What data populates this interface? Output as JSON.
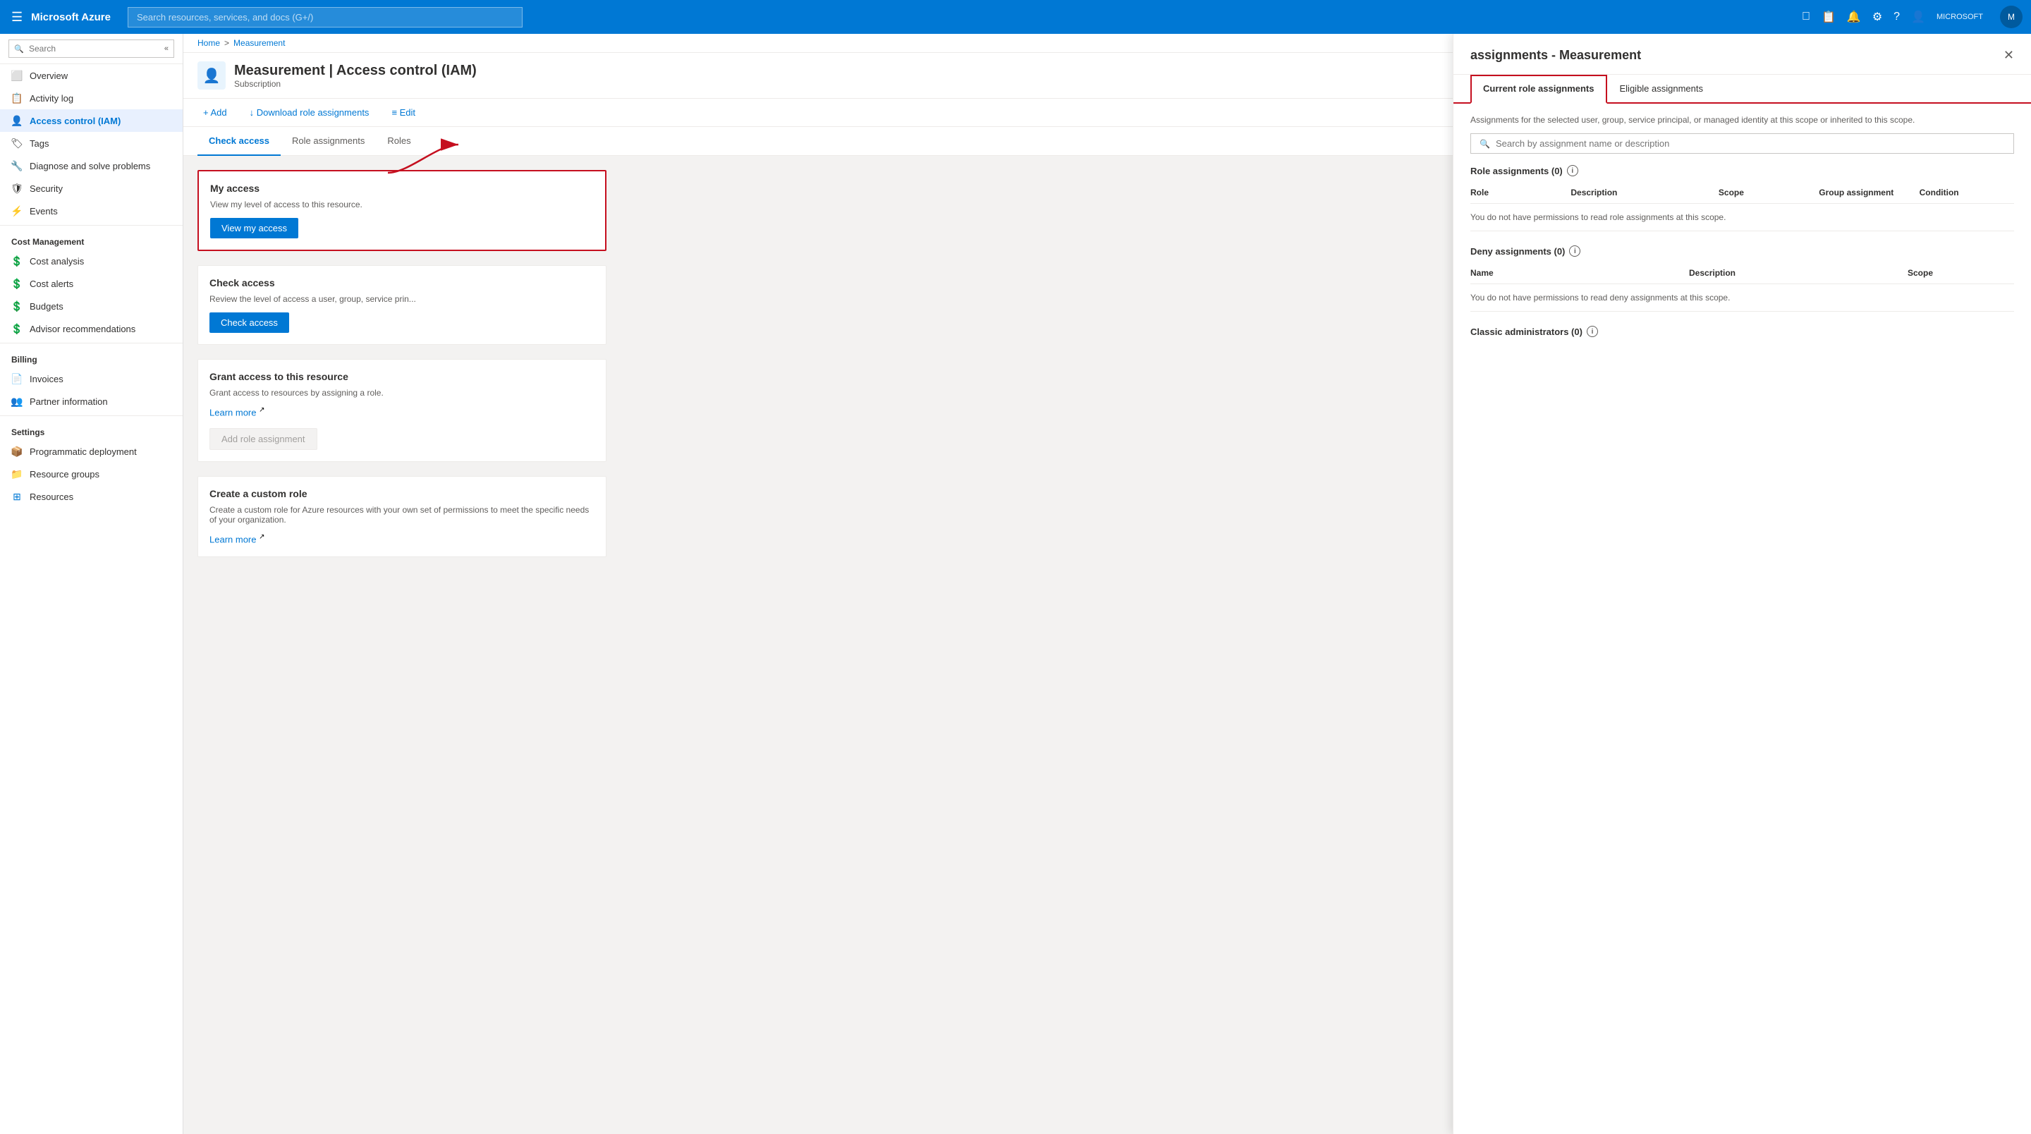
{
  "topbar": {
    "hamburger_icon": "☰",
    "logo": "Microsoft Azure",
    "search_placeholder": "Search resources, services, and docs (G+/)",
    "user_label": "MICROSOFT",
    "avatar_text": "M",
    "icons": [
      "📺",
      "📋",
      "🔔",
      "⚙",
      "?",
      "👤"
    ]
  },
  "breadcrumb": {
    "home": "Home",
    "separator": ">",
    "current": "Measurement"
  },
  "resource": {
    "title": "Measurement | Access control (IAM)",
    "subtitle": "Subscription",
    "menu_icon": "⋯"
  },
  "toolbar": {
    "add_label": "+ Add",
    "download_label": "↓ Download role assignments",
    "edit_label": "≡ Edit"
  },
  "sidebar": {
    "search_placeholder": "Search",
    "items": [
      {
        "label": "Overview",
        "icon": "⬜",
        "active": false
      },
      {
        "label": "Activity log",
        "icon": "📋",
        "active": false
      },
      {
        "label": "Access control (IAM)",
        "icon": "👤",
        "active": true
      },
      {
        "label": "Tags",
        "icon": "🏷",
        "active": false
      },
      {
        "label": "Diagnose and solve problems",
        "icon": "🔧",
        "active": false
      },
      {
        "label": "Security",
        "icon": "🛡",
        "active": false
      },
      {
        "label": "Events",
        "icon": "⚡",
        "active": false
      }
    ],
    "sections": [
      {
        "header": "Cost Management",
        "items": [
          {
            "label": "Cost analysis",
            "icon": "💲"
          },
          {
            "label": "Cost alerts",
            "icon": "💲"
          },
          {
            "label": "Budgets",
            "icon": "💲"
          },
          {
            "label": "Advisor recommendations",
            "icon": "💲"
          }
        ]
      },
      {
        "header": "Billing",
        "items": [
          {
            "label": "Invoices",
            "icon": "📄"
          },
          {
            "label": "Partner information",
            "icon": "👥"
          }
        ]
      },
      {
        "header": "Settings",
        "items": [
          {
            "label": "Programmatic deployment",
            "icon": "📦"
          },
          {
            "label": "Resource groups",
            "icon": "📁"
          },
          {
            "label": "Resources",
            "icon": "⊞"
          }
        ]
      }
    ]
  },
  "page_tabs": [
    {
      "label": "Check access",
      "active": true
    },
    {
      "label": "Role assignments",
      "active": false
    },
    {
      "label": "Roles",
      "active": false
    }
  ],
  "my_access_card": {
    "title": "My access",
    "description": "View my level of access to this resource.",
    "button_label": "View my access"
  },
  "check_access_card": {
    "title": "Check access",
    "description": "Review the level of access a user, group, service prin...",
    "button_label": "Check access"
  },
  "grant_access_card": {
    "title": "Grant access to this resource",
    "description": "Grant access to resources by assigning a role.",
    "learn_more": "Learn more",
    "button_label": "Add role assignment"
  },
  "custom_role_card": {
    "title": "Create a custom role",
    "description": "Create a custom role for Azure resources with your own set of permissions to meet the specific needs of your organization.",
    "learn_more": "Learn more"
  },
  "right_panel": {
    "title": "assignments - Measurement",
    "close_icon": "✕",
    "tabs": [
      {
        "label": "Current role assignments",
        "active": true
      },
      {
        "label": "Eligible assignments",
        "active": false
      }
    ],
    "description": "Assignments for the selected user, group, service principal, or managed identity at this scope or inherited to this scope.",
    "search_placeholder": "Search by assignment name or description",
    "role_assignments_section": {
      "title": "Role assignments (0)",
      "columns": [
        "Role",
        "Description",
        "Scope",
        "Group assignment",
        "Condition"
      ],
      "empty_message": "You do not have permissions to read role assignments at this scope."
    },
    "deny_assignments_section": {
      "title": "Deny assignments (0)",
      "columns": [
        "Name",
        "Description",
        "Scope"
      ],
      "empty_message": "You do not have permissions to read deny assignments at this scope."
    },
    "classic_admins_section": {
      "title": "Classic administrators (0)"
    }
  }
}
